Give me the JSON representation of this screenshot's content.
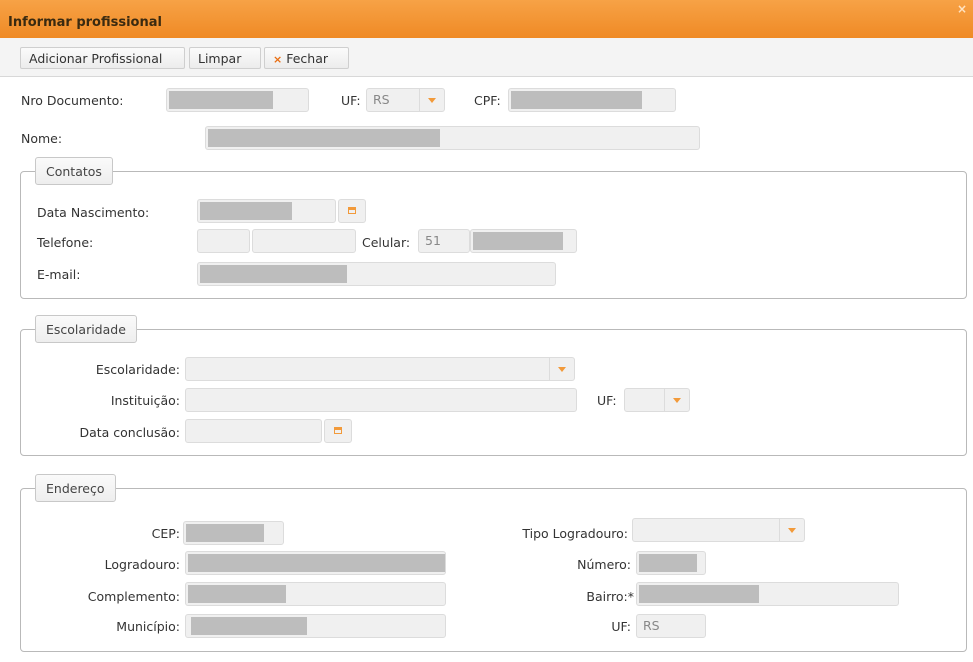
{
  "window": {
    "title": "Informar profissional",
    "close_glyph": "×"
  },
  "toolbar": {
    "add_label": "Adicionar Profissional",
    "clear_label": "Limpar",
    "close_label": "Fechar",
    "close_icon": "×"
  },
  "form": {
    "nro_documento_label": "Nro Documento:",
    "uf_label": "UF:",
    "uf_value": "RS",
    "cpf_label": "CPF:",
    "nome_label": "Nome:"
  },
  "contatos": {
    "legend": "Contatos",
    "data_nascimento_label": "Data Nascimento:",
    "telefone_label": "Telefone:",
    "celular_label": "Celular:",
    "celular_ddd": "51",
    "email_label": "E-mail:"
  },
  "escolaridade": {
    "legend": "Escolaridade",
    "escolaridade_label": "Escolaridade:",
    "instituicao_label": "Instituição:",
    "uf_label": "UF:",
    "data_conclusao_label": "Data conclusão:"
  },
  "endereco": {
    "legend": "Endereço",
    "cep_label": "CEP:",
    "tipo_logradouro_label": "Tipo Logradouro:",
    "logradouro_label": "Logradouro:",
    "numero_label": "Número:",
    "complemento_label": "Complemento:",
    "bairro_label": "Bairro:*",
    "municipio_label": "Município:",
    "uf_label": "UF:",
    "uf_value": "RS"
  },
  "icons": {
    "calendar": "calendar-icon",
    "dropdown": "chevron-down-icon",
    "close": "close-icon"
  },
  "colors": {
    "accent": "#ef8a25",
    "redacted": "#bdbdbd",
    "field_bg": "#f0f0f0"
  }
}
